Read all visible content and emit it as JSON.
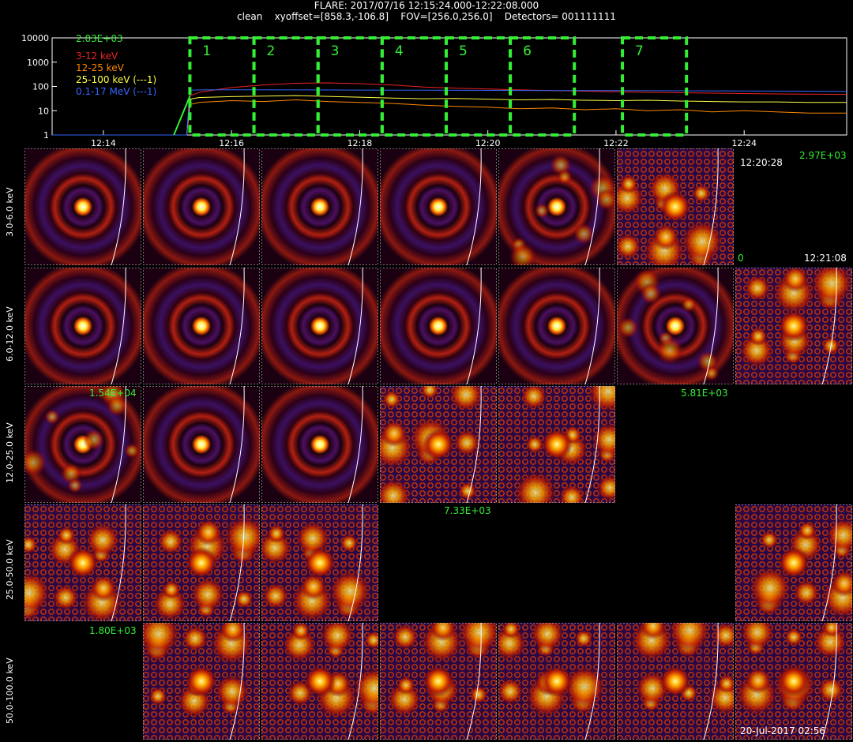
{
  "header": {
    "line1": "FLARE: 2017/07/16 12:15:24.000-12:22:08.000",
    "line2": "clean    xyoffset=[858.3,-106.8]    FOV=[256.0,256.0]    Detectors= 001111111"
  },
  "chart_data": [
    {
      "type": "line",
      "y_log": true,
      "ylim": [
        1,
        10000
      ],
      "y_ticks": [
        "1",
        "10",
        "100",
        "1000",
        "10000"
      ],
      "x_ticks": [
        "12:14",
        "12:16",
        "12:18",
        "12:20",
        "12:22",
        "12:24"
      ],
      "x_ticks_minutes": [
        14,
        16,
        18,
        20,
        22,
        24
      ],
      "xlim_minutes": [
        13.2,
        25.6
      ],
      "peak_label": "2.03E+03",
      "legend": [
        {
          "name": "3-12 keV",
          "color": "#ee2222"
        },
        {
          "name": "12-25 keV",
          "color": "#ff8800"
        },
        {
          "name": "25-100 keV (---1)",
          "color": "#ffff44"
        },
        {
          "name": "0.1-17 MeV (---1)",
          "color": "#3366ff"
        }
      ],
      "series": [
        {
          "name": "3-12 keV",
          "color": "#ee2222",
          "x": [
            13.2,
            14.0,
            15.0,
            15.3,
            15.35,
            15.5,
            16.0,
            16.5,
            17.0,
            17.5,
            18.0,
            18.5,
            19.0,
            19.5,
            20.0,
            20.5,
            21.0,
            21.5,
            22.0,
            22.5,
            23.0,
            23.5,
            24.0,
            24.5,
            25.0,
            25.6
          ],
          "y": [
            1,
            1,
            1,
            1,
            40,
            58,
            90,
            115,
            135,
            140,
            130,
            115,
            95,
            85,
            78,
            72,
            68,
            64,
            60,
            57,
            55,
            53,
            51,
            49,
            48,
            47
          ]
        },
        {
          "name": "12-25 keV",
          "color": "#ff8800",
          "x": [
            13.2,
            14.0,
            15.0,
            15.3,
            15.35,
            15.5,
            16.0,
            16.5,
            17.0,
            17.5,
            18.0,
            18.5,
            19.0,
            19.5,
            20.0,
            20.5,
            21.0,
            21.5,
            22.0,
            22.5,
            23.0,
            23.5,
            24.0,
            24.5,
            25.0,
            25.6
          ],
          "y": [
            1,
            1,
            1,
            1,
            18,
            22,
            26,
            24,
            28,
            24,
            22,
            20,
            17,
            15,
            14,
            12,
            13,
            11,
            12,
            10,
            11,
            9,
            10,
            9,
            8,
            8
          ]
        },
        {
          "name": "25-100 keV (---1)",
          "color": "#ffff44",
          "x": [
            13.2,
            14.0,
            15.0,
            15.3,
            15.35,
            15.5,
            16.0,
            16.5,
            17.0,
            17.5,
            18.0,
            18.5,
            19.0,
            19.5,
            20.0,
            20.5,
            21.0,
            21.5,
            22.0,
            22.5,
            23.0,
            23.5,
            24.0,
            24.5,
            25.0,
            25.6
          ],
          "y": [
            1,
            1,
            1,
            1,
            30,
            35,
            38,
            40,
            42,
            39,
            36,
            33,
            31,
            32,
            30,
            28,
            29,
            27,
            26,
            27,
            25,
            24,
            23,
            23,
            22,
            22
          ]
        },
        {
          "name": "0.1-17 MeV (---1)",
          "color": "#3366ff",
          "x": [
            13.2,
            14.0,
            15.0,
            15.3,
            15.35,
            15.5,
            16.0,
            17.0,
            18.0,
            19.0,
            20.0,
            21.0,
            22.0,
            23.0,
            24.0,
            25.0,
            25.6
          ],
          "y": [
            1,
            1,
            1,
            1,
            70,
            72,
            73,
            72,
            71,
            70,
            69,
            68,
            67,
            66,
            65,
            64,
            63
          ]
        }
      ],
      "intervals": [
        {
          "label": "1",
          "start": 15.35,
          "end": 16.35
        },
        {
          "label": "2",
          "start": 16.35,
          "end": 17.35
        },
        {
          "label": "3",
          "start": 17.35,
          "end": 18.35
        },
        {
          "label": "4",
          "start": 18.35,
          "end": 19.35
        },
        {
          "label": "5",
          "start": 19.35,
          "end": 20.35
        },
        {
          "label": "6",
          "start": 20.35,
          "end": 21.35
        },
        {
          "label": "7",
          "start": 22.1,
          "end": 23.1
        }
      ]
    },
    {
      "type": "heatmap",
      "rows": [
        "3.0-6.0 keV",
        "6.0-12.0 keV",
        "12.0-25.0 keV",
        "25.0-50.0 keV",
        "50.0-100.0 keV"
      ],
      "columns": [
        "1",
        "2",
        "3",
        "4",
        "5",
        "6",
        "7"
      ],
      "cells": [
        [
          "rings",
          "rings",
          "rings",
          "rings",
          "rings-noisy",
          "speckle",
          "empty"
        ],
        [
          "rings",
          "rings",
          "rings",
          "rings",
          "rings",
          "rings-noisy",
          "speckle"
        ],
        [
          "rings-noisy",
          "rings",
          "rings",
          "speckle",
          "speckle",
          "empty",
          "empty"
        ],
        [
          "speckle",
          "speckle",
          "speckle",
          "empty",
          "empty",
          "empty",
          "speckle"
        ],
        [
          "empty",
          "speckle",
          "speckle",
          "speckle",
          "speckle",
          "speckle",
          "speckle"
        ]
      ],
      "peak_labels": {
        "row1": "2.97E+03",
        "row2": "5.81E+03",
        "row3": "1.54E+04",
        "row4": "7.33E+03",
        "row5": "1.80E+03"
      },
      "time_label_top": "12:20:28",
      "time_label_bottom": "12:21:08",
      "time_label_small": "0",
      "stamp": "20-Jul-2017 02:56"
    }
  ]
}
